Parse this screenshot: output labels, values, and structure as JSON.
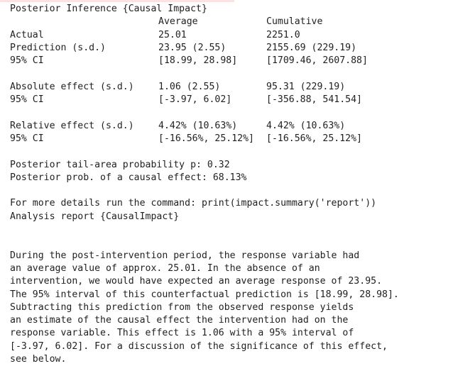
{
  "summary": {
    "title": "Posterior Inference {Causal Impact}",
    "columns": [
      "Average",
      "Cumulative"
    ],
    "rows": [
      {
        "label": "Actual",
        "average": "25.01",
        "cumulative": "2251.0"
      },
      {
        "label": "Prediction (s.d.)",
        "average": "23.95 (2.55)",
        "cumulative": "2155.69 (229.19)"
      },
      {
        "label": "95% CI",
        "average": "[18.99, 28.98]",
        "cumulative": "[1709.46, 2607.88]"
      },
      {
        "label": "Absolute effect (s.d.)",
        "average": "1.06 (2.55)",
        "cumulative": "95.31 (229.19)"
      },
      {
        "label": "95% CI",
        "average": "[-3.97, 6.02]",
        "cumulative": "[-356.88, 541.54]"
      },
      {
        "label": "Relative effect (s.d.)",
        "average": "4.42% (10.63%)",
        "cumulative": "4.42% (10.63%)"
      },
      {
        "label": "95% CI",
        "average": "[-16.56%, 25.12%]",
        "cumulative": "[-16.56%, 25.12%]"
      }
    ],
    "tail_prob": "Posterior tail-area probability p: 0.32",
    "causal_prob": "Posterior prob. of a causal effect: 68.13%",
    "more_details": "For more details run the command: print(impact.summary('report'))"
  },
  "report": {
    "title": "Analysis report {CausalImpact}",
    "lines": [
      "During the post-intervention period, the response variable had",
      "an average value of approx. 25.01. In the absence of an",
      "intervention, we would have expected an average response of 23.95.",
      "The 95% interval of this counterfactual prediction is [18.99, 28.98].",
      "Subtracting this prediction from the observed response yields",
      "an estimate of the causal effect the intervention had on the",
      "response variable. This effect is 1.06 with a 95% interval of",
      "[-3.97, 6.02]. For a discussion of the significance of this effect,",
      "see below."
    ]
  }
}
